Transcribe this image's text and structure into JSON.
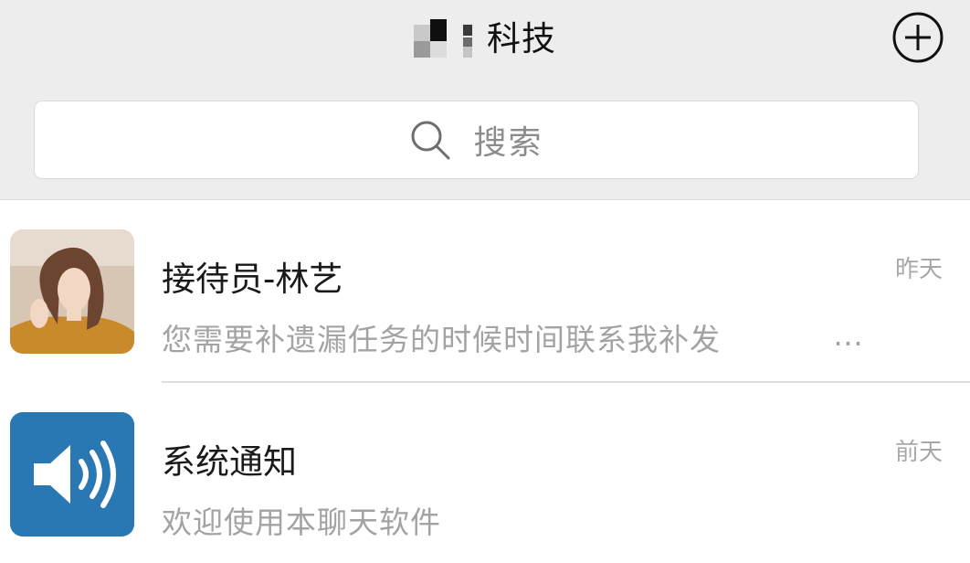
{
  "header": {
    "title_suffix": "科技",
    "add_icon": "plus-circle-icon"
  },
  "search": {
    "label": "搜索",
    "icon": "search-icon"
  },
  "conversations": [
    {
      "name": "接待员-林艺",
      "preview": "您需要补遗漏任务的时候时间联系我补发",
      "preview_more": "…",
      "time": "昨天",
      "avatar": "portrait-photo"
    },
    {
      "name": "系统通知",
      "preview": "欢迎使用本聊天软件",
      "time": "前天",
      "avatar": "speaker-icon"
    }
  ],
  "colors": {
    "header_bg": "#ededed",
    "speaker_tile": "#2a78b3"
  }
}
